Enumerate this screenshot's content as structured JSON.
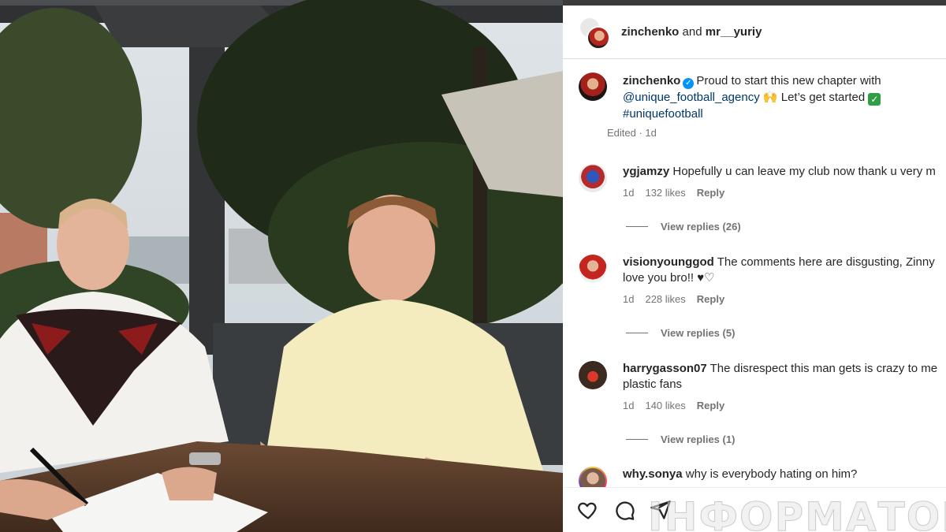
{
  "header": {
    "user1": "zinchenko",
    "joiner": "and",
    "user2": "mr__yuriy"
  },
  "caption": {
    "user": "zinchenko",
    "text_before_link": "Proud to start this new chapter with",
    "mention": "@unique_football_agency",
    "text_after": "Let’s get started",
    "hashtag": "#uniquefootball",
    "meta": "Edited · 1d"
  },
  "comments": [
    {
      "user": "ygjamzy",
      "text": "Hopefully u can leave my club now thank u very m",
      "line2": "",
      "age": "1d",
      "likes": "132 likes",
      "reply": "Reply",
      "view_replies": "View replies (26)"
    },
    {
      "user": "visionyounggod",
      "text": "The comments here are disgusting, Zinny",
      "line2": "love you bro!! ♥♡",
      "age": "1d",
      "likes": "228 likes",
      "reply": "Reply",
      "view_replies": "View replies (5)"
    },
    {
      "user": "harrygasson07",
      "text": "The disrespect this man gets is crazy to me",
      "line2": "plastic fans",
      "age": "1d",
      "likes": "140 likes",
      "reply": "Reply",
      "view_replies": "View replies (1)"
    },
    {
      "user": "why.sonya",
      "text": "why is everybody hating on him?",
      "line2": ""
    }
  ],
  "watermark": "ІНФОРМАТОР",
  "icons": [
    "heart-icon",
    "comment-icon",
    "share-icon",
    "verified-icon"
  ],
  "colors": {
    "link": "#00376b",
    "verified": "#0095f6",
    "meta": "#737373"
  }
}
